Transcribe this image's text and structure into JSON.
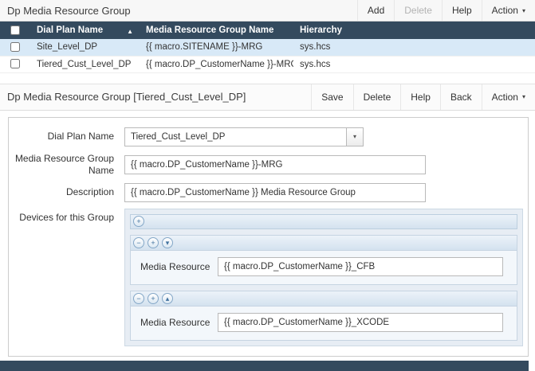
{
  "colors": {
    "header_navy": "#344a5e",
    "selected_row_blue": "#d8e9f7",
    "panel_blue": "#e7edf4"
  },
  "icons": {
    "caret_down": "▾",
    "sort_asc": "▲",
    "plus": "+",
    "minus": "−",
    "move_down": "▾",
    "move_up": "▴",
    "dropdown_arrow": "▾"
  },
  "list_section": {
    "title": "Dp Media Resource Group",
    "toolbar": {
      "add": "Add",
      "delete": "Delete",
      "help": "Help",
      "action": "Action"
    },
    "table": {
      "columns": {
        "dial_plan_name": "Dial Plan Name",
        "mrg_name": "Media Resource Group Name",
        "hierarchy": "Hierarchy"
      },
      "rows": [
        {
          "dial_plan_name": "Site_Level_DP",
          "mrg_name": "{{ macro.SITENAME }}-MRG",
          "hierarchy": "sys.hcs",
          "selected": true
        },
        {
          "dial_plan_name": "Tiered_Cust_Level_DP",
          "mrg_name": "{{ macro.DP_CustomerName }}-MRG",
          "hierarchy": "sys.hcs",
          "selected": false
        }
      ]
    }
  },
  "detail_section": {
    "title": "Dp Media Resource Group [Tiered_Cust_Level_DP]",
    "toolbar": {
      "save": "Save",
      "delete": "Delete",
      "help": "Help",
      "back": "Back",
      "action": "Action"
    },
    "form": {
      "dial_plan": {
        "label": "Dial Plan Name",
        "value": "Tiered_Cust_Level_DP"
      },
      "mrg_name": {
        "label": "Media Resource Group Name",
        "value": "{{ macro.DP_CustomerName }}-MRG"
      },
      "description": {
        "label": "Description",
        "value": "{{ macro.DP_CustomerName }} Media Resource Group"
      },
      "devices": {
        "label": "Devices for this Group",
        "items": [
          {
            "label": "Media Resource",
            "value": "{{ macro.DP_CustomerName }}_CFB"
          },
          {
            "label": "Media Resource",
            "value": "{{ macro.DP_CustomerName }}_XCODE"
          }
        ]
      }
    }
  }
}
